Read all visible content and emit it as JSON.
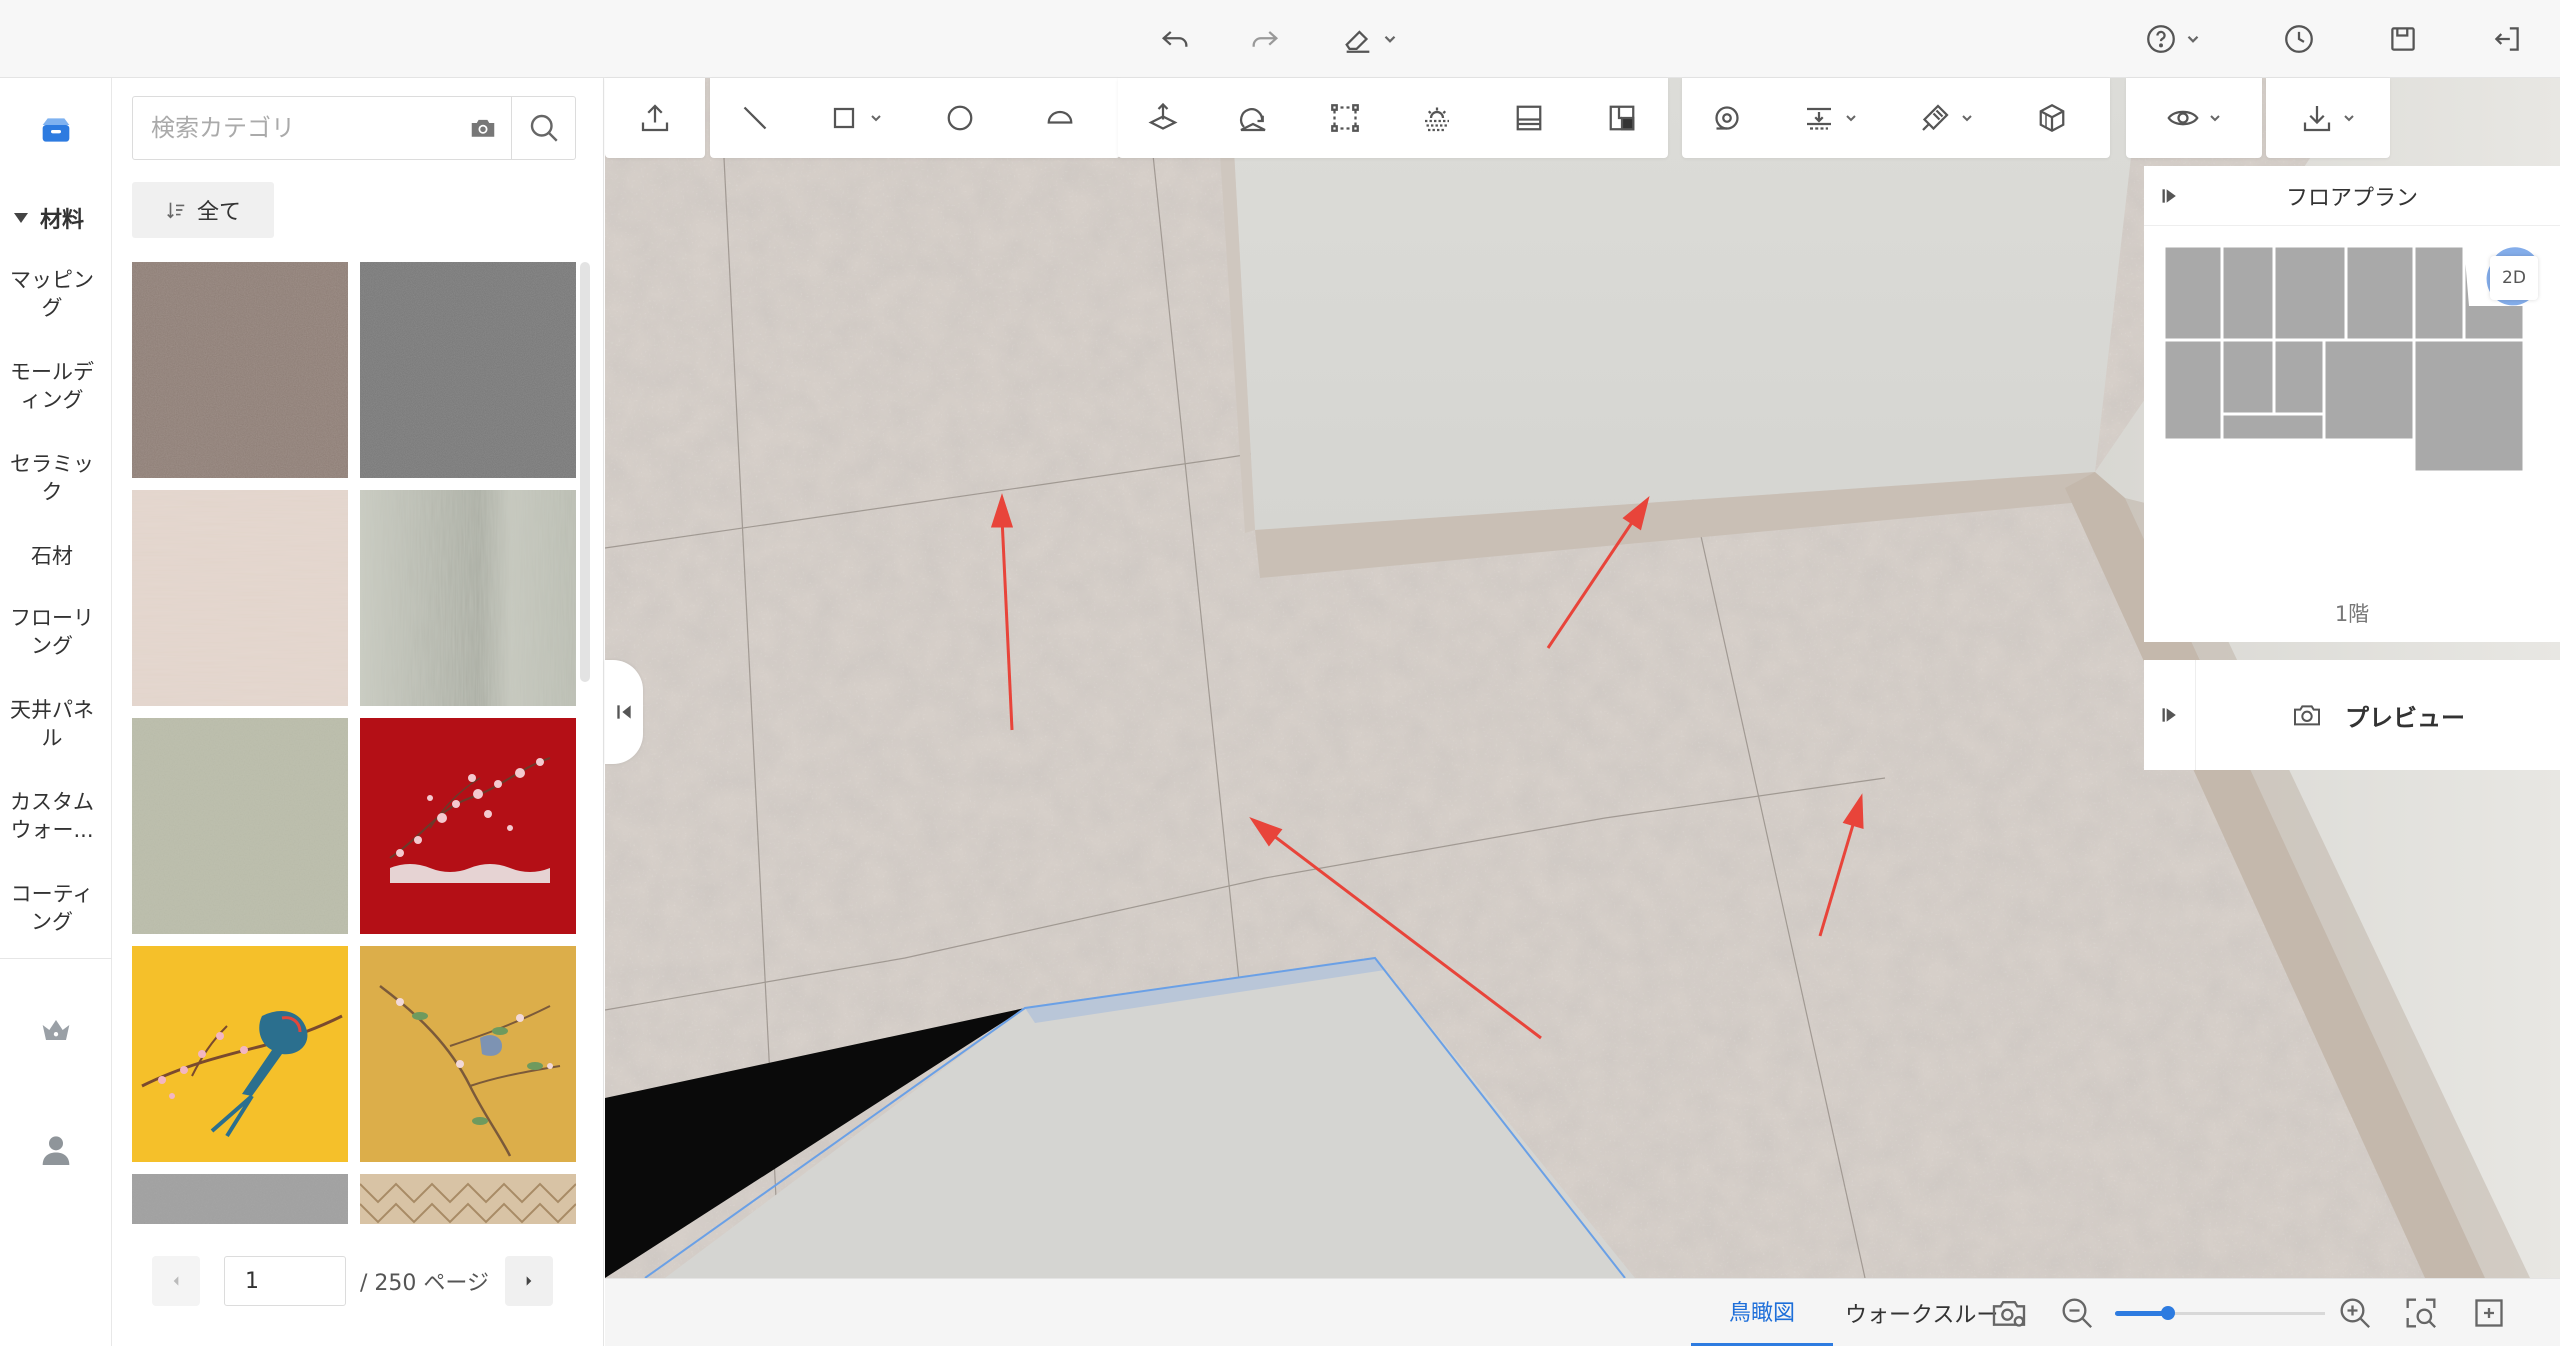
{
  "topbar": {
    "undo_icon": "undo-icon",
    "redo_icon": "redo-icon",
    "eraser_icon": "eraser-icon",
    "help_icon": "help-icon",
    "history_icon": "clock-icon",
    "save_icon": "save-icon",
    "exit_icon": "exit-icon"
  },
  "rail": {
    "section_label": "材料",
    "items": [
      {
        "label": "マッピング"
      },
      {
        "label": "モールディング"
      },
      {
        "label": "セラミック"
      },
      {
        "label": "石材"
      },
      {
        "label": "フローリング"
      },
      {
        "label": "天井パネル"
      },
      {
        "label": "カスタムウォー..."
      },
      {
        "label": "コーティング"
      }
    ],
    "crown_icon": "crown-icon",
    "user_icon": "user-icon"
  },
  "panel": {
    "search_placeholder": "検索カテゴリ",
    "filter_label": "全て",
    "pagination": {
      "current_page": "1",
      "total_label": "/ 250 ページ"
    }
  },
  "toolbar": {
    "groups": [
      [
        "upload-icon"
      ],
      [
        "line-icon",
        "rectangle-icon",
        "circle-icon",
        "arc-icon"
      ],
      [
        "move-up-icon",
        "rotate-icon",
        "select-box-icon",
        "light-icon",
        "panel-icon",
        "layout-icon"
      ],
      [
        "tape-icon",
        "align-icon",
        "brush-icon",
        "cube-icon"
      ],
      [
        "eye-icon"
      ],
      [
        "download-icon"
      ]
    ]
  },
  "floorplan": {
    "title": "フロアプラン",
    "view_2d": "2D",
    "floor_label": "1階"
  },
  "preview": {
    "label": "プレビュー"
  },
  "bottombar": {
    "tabs": [
      {
        "label": "鳥瞰図",
        "active": true
      },
      {
        "label": "ウォークスルー",
        "active": false
      }
    ],
    "zoom_level": 0.25
  },
  "colors": {
    "accent": "#2d7be0",
    "annotation_arrow": "#e8443a"
  }
}
